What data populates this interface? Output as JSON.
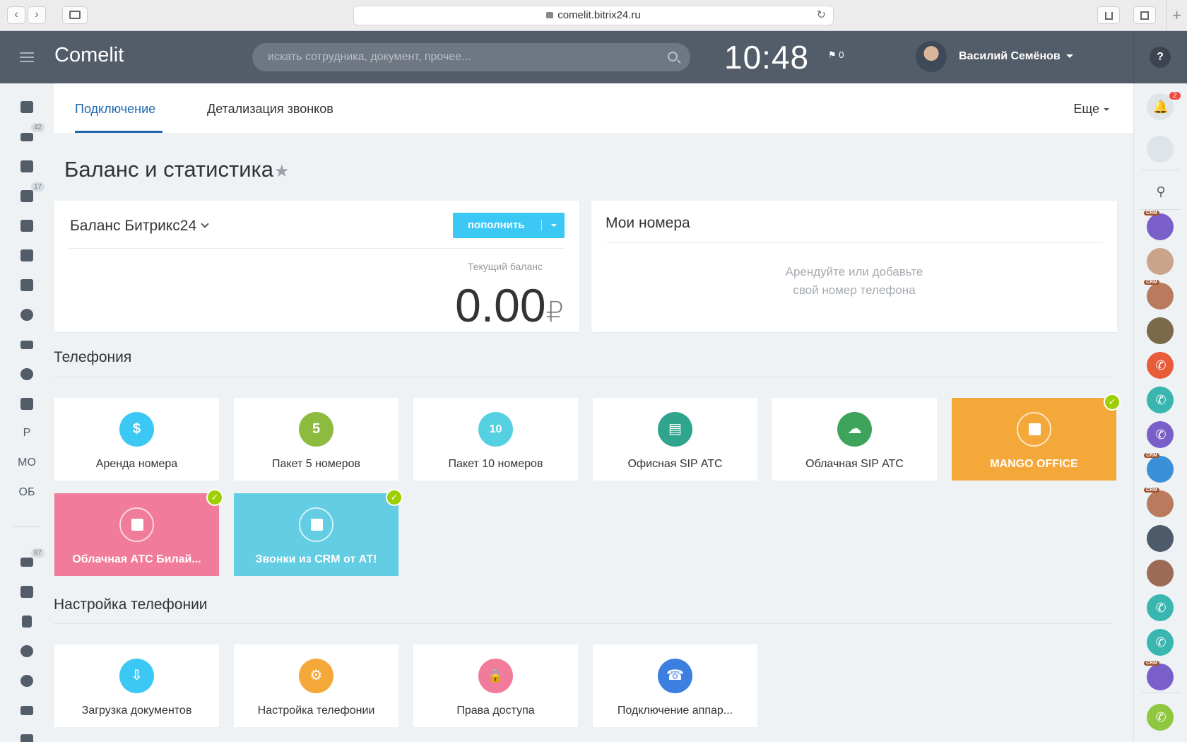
{
  "browser": {
    "url": "comelit.bitrix24.ru",
    "back_icon": "‹",
    "forward_icon": "›"
  },
  "header": {
    "logo": "Comelit",
    "search_placeholder": "искать сотрудника, документ, прочее...",
    "time": "10:48",
    "flag_count": "0",
    "user_name": "Василий Семёнов",
    "help": "?"
  },
  "left_sidebar": {
    "badges": {
      "feed": "42",
      "tasks": "17",
      "mail": "87"
    },
    "text_items": [
      "Р",
      "МО",
      "ОБ"
    ]
  },
  "right_sidebar": {
    "notifications_count": "2",
    "crm_badge": "CRM"
  },
  "tabs": [
    {
      "label": "Подключение",
      "active": true
    },
    {
      "label": "Детализация звонков",
      "active": false
    }
  ],
  "more_label": "Еще",
  "page_title": "Баланс и статистика",
  "balance": {
    "title": "Баланс Битрикс24",
    "topup_label": "пополнить",
    "current_label": "Текущий баланс",
    "value": "0.00",
    "currency": "₽"
  },
  "numbers": {
    "title": "Мои номера",
    "empty_line1": "Арендуйте или добавьте",
    "empty_line2": "свой номер телефона"
  },
  "telephony": {
    "title": "Телефония",
    "tiles": [
      {
        "label": "Аренда номера",
        "glyph": "$",
        "color": "#3bc8f5",
        "connected": false
      },
      {
        "label": "Пакет 5 номеров",
        "glyph": "5",
        "color": "#8dbb3f",
        "connected": false
      },
      {
        "label": "Пакет 10 номеров",
        "glyph": "10",
        "color": "#55d0e0",
        "connected": false
      },
      {
        "label": "Офисная SIP АТС",
        "glyph": "▤",
        "color": "#2fa58e",
        "connected": false
      },
      {
        "label": "Облачная SIP АТС",
        "glyph": "☁",
        "color": "#3fa45b",
        "connected": false
      },
      {
        "label": "MANGO OFFICE",
        "color": "#f5a83a",
        "connected": true
      },
      {
        "label": "Облачная АТС Билай...",
        "color": "#f07b9b",
        "connected": true
      },
      {
        "label": "Звонки из CRM от АТ!",
        "color": "#63cde3",
        "connected": true
      }
    ],
    "check": "✓"
  },
  "settings": {
    "title": "Настройка телефонии",
    "tiles": [
      {
        "label": "Загрузка документов",
        "glyph": "⇩",
        "color": "#3bc8f5"
      },
      {
        "label": "Настройка телефонии",
        "glyph": "⚙",
        "color": "#f5a83a"
      },
      {
        "label": "Права доступа",
        "glyph": "🔒",
        "color": "#f07b9b"
      },
      {
        "label": "Подключение аппар...",
        "glyph": "☎",
        "color": "#3d7fe0"
      }
    ]
  }
}
